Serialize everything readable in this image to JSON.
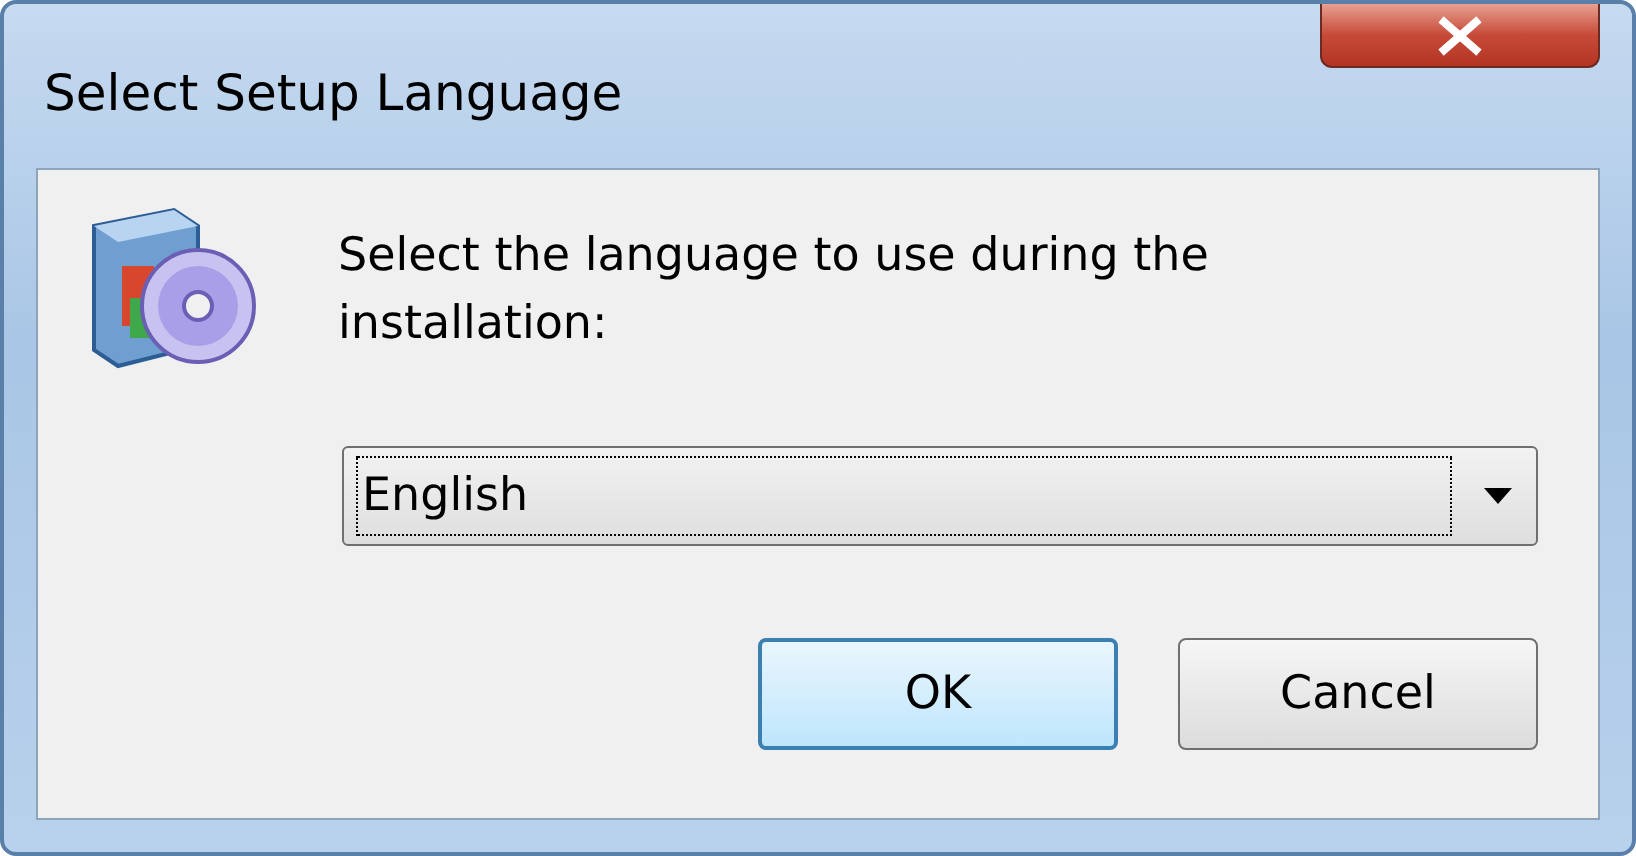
{
  "window": {
    "title": "Select Setup Language"
  },
  "message": "Select the language to use during the installation:",
  "language_dropdown": {
    "value": "English",
    "focused": true
  },
  "buttons": [
    {
      "label": "OK",
      "default": true
    },
    {
      "label": "Cancel",
      "default": false
    }
  ]
}
